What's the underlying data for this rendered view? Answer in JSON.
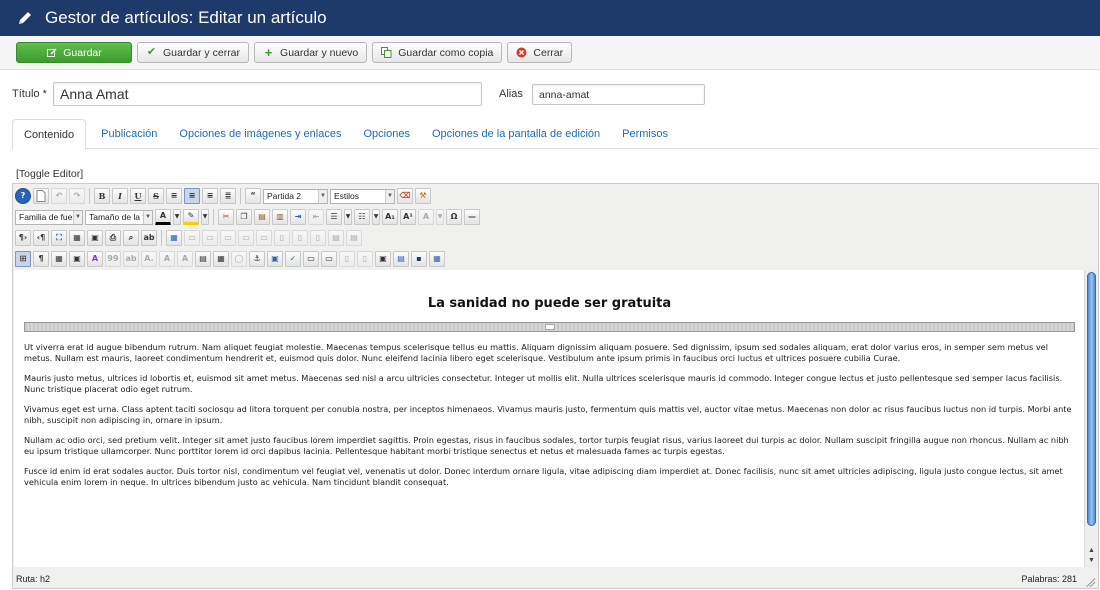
{
  "header": {
    "title": "Gestor de artículos: Editar un artículo"
  },
  "toolbar": {
    "save": "Guardar",
    "save_close": "Guardar y cerrar",
    "save_new": "Guardar y nuevo",
    "save_copy": "Guardar como copia",
    "close": "Cerrar"
  },
  "form": {
    "title_label": "Título *",
    "title_value": "Anna Amat",
    "alias_label": "Alias",
    "alias_value": "anna-amat"
  },
  "tabs": [
    {
      "label": "Contenido",
      "active": true
    },
    {
      "label": "Publicación"
    },
    {
      "label": "Opciones de imágenes y enlaces"
    },
    {
      "label": "Opciones"
    },
    {
      "label": "Opciones de la pantalla de edición"
    },
    {
      "label": "Permisos"
    }
  ],
  "editor": {
    "toggle": "[Toggle Editor]",
    "format_select": "Partida 2",
    "styles_select": "Estilos",
    "font_family_select": "Familia de fuente",
    "font_size_select": "Tamaño de la fuente",
    "heading": "La sanidad no puede ser gratuita",
    "paragraphs": [
      "Ut viverra erat id augue bibendum rutrum. Nam aliquet feugiat molestie. Maecenas tempus scelerisque tellus eu mattis. Aliquam dignissim aliquam posuere. Sed dignissim, ipsum sed sodales aliquam, erat dolor varius eros, in semper sem metus vel metus. Nullam est mauris, laoreet condimentum hendrerit et, euismod quis dolor. Nunc eleifend lacinia libero eget scelerisque. Vestibulum ante ipsum primis in faucibus orci luctus et ultrices posuere cubilia Curae.",
      "Mauris justo metus, ultrices id lobortis et, euismod sit amet metus. Maecenas sed nisl a arcu ultricies consectetur. Integer ut mollis elit. Nulla ultrices scelerisque mauris id commodo. Integer congue lectus et justo pellentesque sed semper lacus facilisis. Nunc tristique placerat odio eget rutrum.",
      "Vivamus eget est urna. Class aptent taciti sociosqu ad litora torquent per conubia nostra, per inceptos himenaeos. Vivamus mauris justo, fermentum quis mattis vel, auctor vitae metus. Maecenas non dolor ac risus faucibus luctus non id turpis. Morbi ante nibh, suscipit non adipiscing in, ornare in ipsum.",
      "Nullam ac odio orci, sed pretium velit. Integer sit amet justo faucibus lorem imperdiet sagittis. Proin egestas, risus in faucibus sodales, tortor turpis feugiat risus, varius laoreet dui turpis ac dolor. Nullam suscipit fringilla augue non rhoncus. Nullam ac nibh eu ipsum tristique ullamcorper. Nunc porttitor lorem id orci dapibus lacinia. Pellentesque habitant morbi tristique senectus et netus et malesuada fames ac turpis egestas.",
      "Fusce id enim id erat sodales auctor. Duis tortor nisl, condimentum vel feugiat vel, venenatis ut dolor. Donec interdum ornare ligula, vitae adipiscing diam imperdiet at. Donec facilisis, nunc sit amet ultricies adipiscing, ligula justo congue lectus, sit amet vehicula enim lorem in neque. In ultrices bibendum justo ac vehicula. Nam tincidunt blandit consequat."
    ],
    "status_path": "Ruta:  h2",
    "status_words": "Palabras: 281"
  },
  "colors": {
    "header_bg": "#1d3a6b",
    "save_green": "#4cae3c",
    "link_blue": "#1e6bb8"
  }
}
